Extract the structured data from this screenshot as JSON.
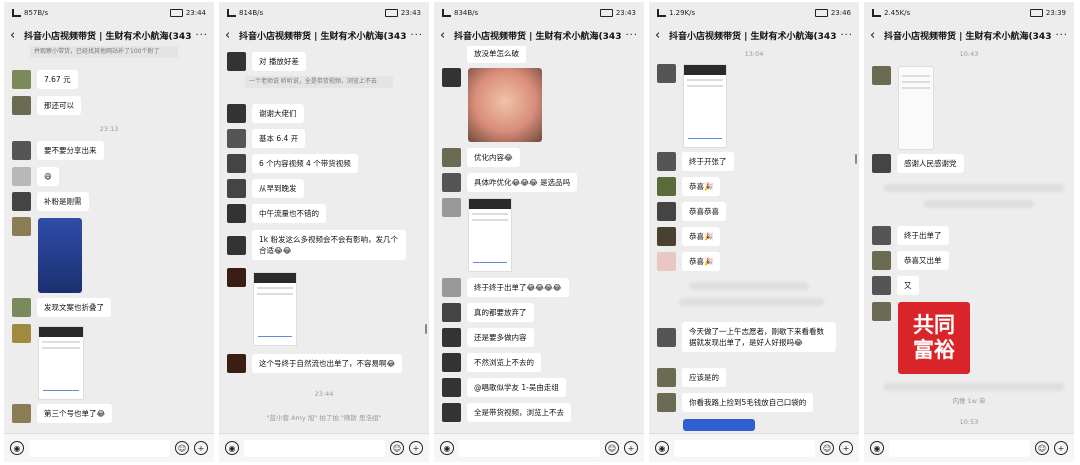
{
  "common": {
    "title": "抖音小店视频带货 | 生财有术小航海(343)",
    "back_icon": "‹",
    "more_icon": "···",
    "voice_icon": "◉",
    "emoji_icon": "☺",
    "plus_icon": "+"
  },
  "panels": [
    {
      "status": {
        "speed": "857B/s",
        "time": "23:44",
        "battery": "35"
      },
      "sys": [
        "并观察小带货，已经找其他网站补了100个粉了",
        "23:13"
      ],
      "messages": [
        "7.67 元",
        "那还可以",
        "要不要分享出来",
        "😄",
        "补粉是刚需",
        "发现文案也折叠了",
        "第三个号也单了😂"
      ]
    },
    {
      "status": {
        "speed": "814B/s",
        "time": "23:43",
        "battery": "35"
      },
      "sys": [
        "一个老师说 听听说，全是带货视频，浏览上不去",
        "23:44",
        "\"蓝小蓉 Amy 旭\" 拍了拍 \"隋斯 思浩组\""
      ],
      "messages": [
        "对 播放好差",
        "谢谢大佬们",
        "基本 6.4 开",
        "6 个内容视频 4 个带货视频",
        "从早到晚发",
        "中午流量也不错的",
        "1k 粉发这么多视频会不会有影响，发几个合适😂😂",
        "这个号终于自然流也出单了，不容易啊😂"
      ]
    },
    {
      "status": {
        "speed": "834B/s",
        "time": "23:43",
        "battery": "35"
      },
      "sys": [],
      "messages": [
        "放没单怎么破",
        "优化内容😂",
        "具体咋优化😂😂😂 是选品吗",
        "终于终于出单了😂😂😂😂",
        "真的都要放弃了",
        "还是要多做内容",
        "不然浏览上不去的",
        "@唱歌似学友 1-吴由走组",
        "全是带货视频，浏览上不去"
      ]
    },
    {
      "status": {
        "speed": "1.29K/s",
        "time": "23:46",
        "battery": "35"
      },
      "sys": [
        "13:04"
      ],
      "messages": [
        "终于开张了",
        "恭喜🎉",
        "恭喜恭喜",
        "恭喜🎉",
        "恭喜🎉",
        "今天做了一上午志愿者，刚歇下来看看数据就发现出单了，是好人好报吗😂",
        "应该是的",
        "你看我路上捡到5毛钱放自己口袋的"
      ]
    },
    {
      "status": {
        "speed": "2.45K/s",
        "time": "23:39",
        "battery": "35"
      },
      "sys": [
        "10:43",
        "内推 1w 单",
        "10:53"
      ],
      "messages": [
        "感谢人民感谢党",
        "终于出单了",
        "恭喜又出单",
        "又"
      ],
      "sticker": [
        "共同",
        "富裕"
      ]
    }
  ],
  "colors": {
    "chat_bg": "#ededed",
    "bubble": "#ffffff",
    "sticker_red": "#d9242a"
  }
}
